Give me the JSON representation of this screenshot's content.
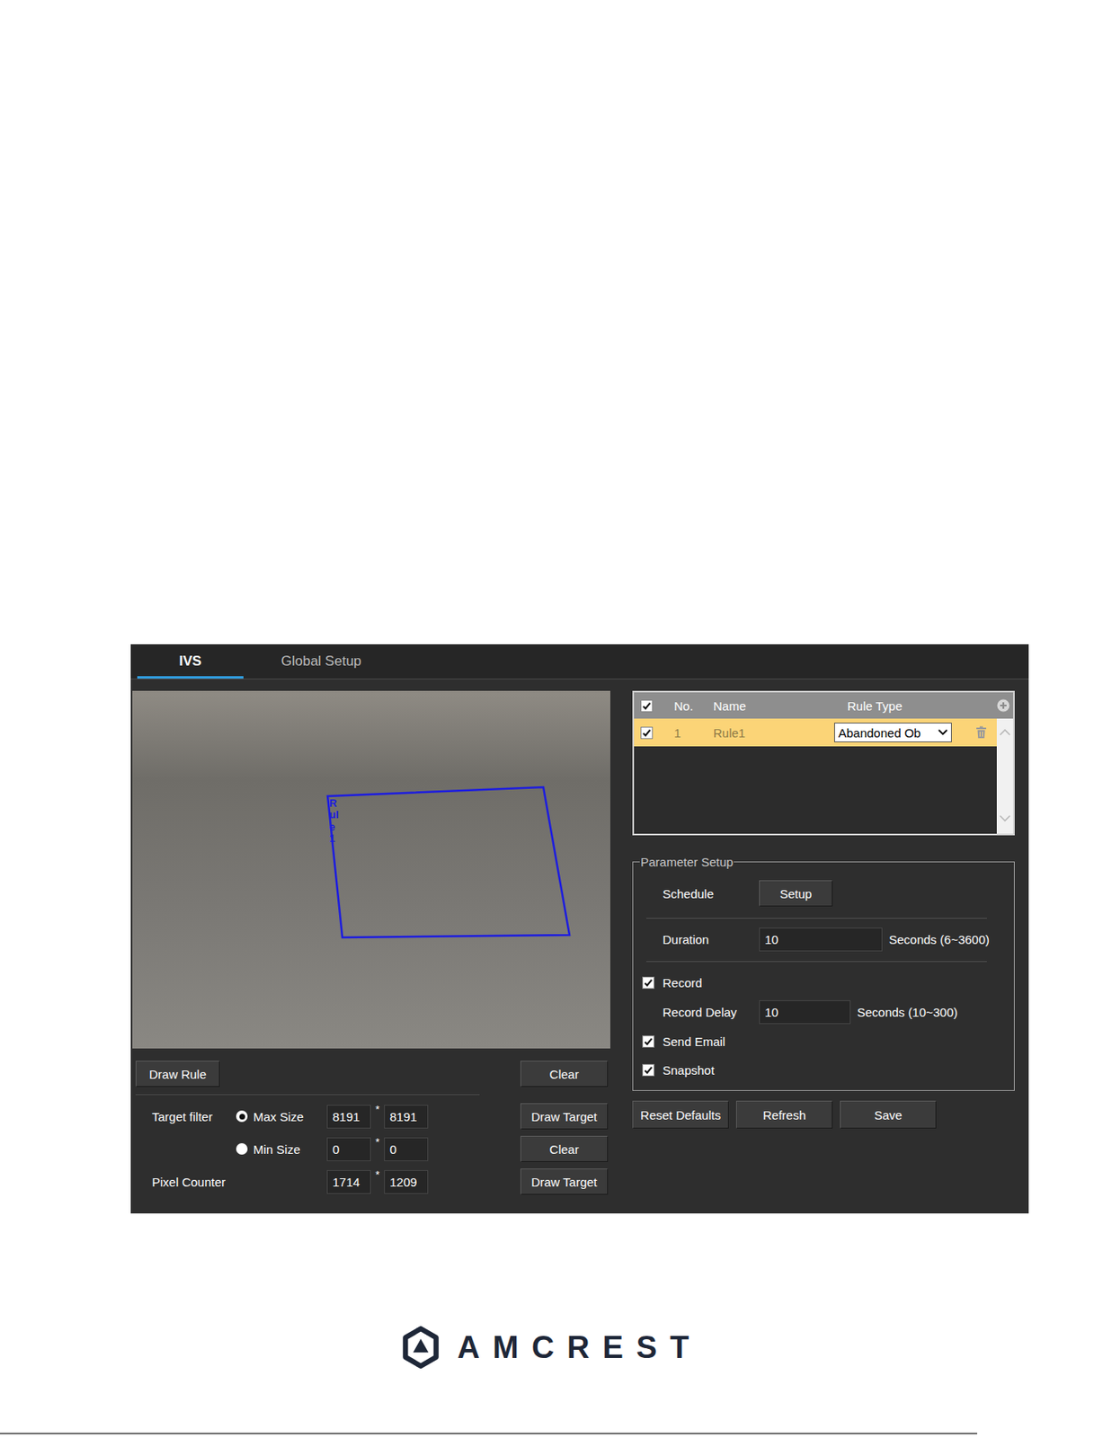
{
  "tabs": [
    {
      "label": "IVS",
      "selected": true
    },
    {
      "label": "Global Setup",
      "selected": false
    }
  ],
  "video": {
    "rule_label": "Rule1"
  },
  "video_buttons": {
    "draw_rule": "Draw Rule",
    "clear": "Clear"
  },
  "target_filter": {
    "label": "Target filter",
    "separator": "*",
    "options": [
      {
        "label": "Max Size",
        "selected": true,
        "width": "8191",
        "height": "8191",
        "button": "Draw Target"
      },
      {
        "label": "Min Size",
        "selected": false,
        "width": "0",
        "height": "0",
        "button": "Clear"
      }
    ]
  },
  "pixel_counter": {
    "label": "Pixel Counter",
    "width": "1714",
    "height": "1209",
    "button": "Draw Target"
  },
  "rules_table": {
    "all_checked": true,
    "columns": [
      "No.",
      "Name",
      "Rule Type"
    ],
    "rows": [
      {
        "checked": true,
        "selected": true,
        "no": "1",
        "name": "Rule1",
        "rule_type": "Abandoned Ob"
      }
    ]
  },
  "parameter_setup": {
    "legend": "Parameter Setup",
    "schedule": {
      "label": "Schedule",
      "button": "Setup"
    },
    "duration": {
      "label": "Duration",
      "value": "10",
      "hint": "Seconds (6~3600)"
    },
    "record": {
      "label": "Record",
      "checked": true
    },
    "record_delay": {
      "label": "Record Delay",
      "value": "10",
      "hint": "Seconds (10~300)"
    },
    "send_email": {
      "label": "Send Email",
      "checked": true
    },
    "snapshot": {
      "label": "Snapshot",
      "checked": true
    }
  },
  "actions": [
    "Reset Defaults",
    "Refresh",
    "Save"
  ],
  "footer": {
    "logo": "AMCREST"
  }
}
